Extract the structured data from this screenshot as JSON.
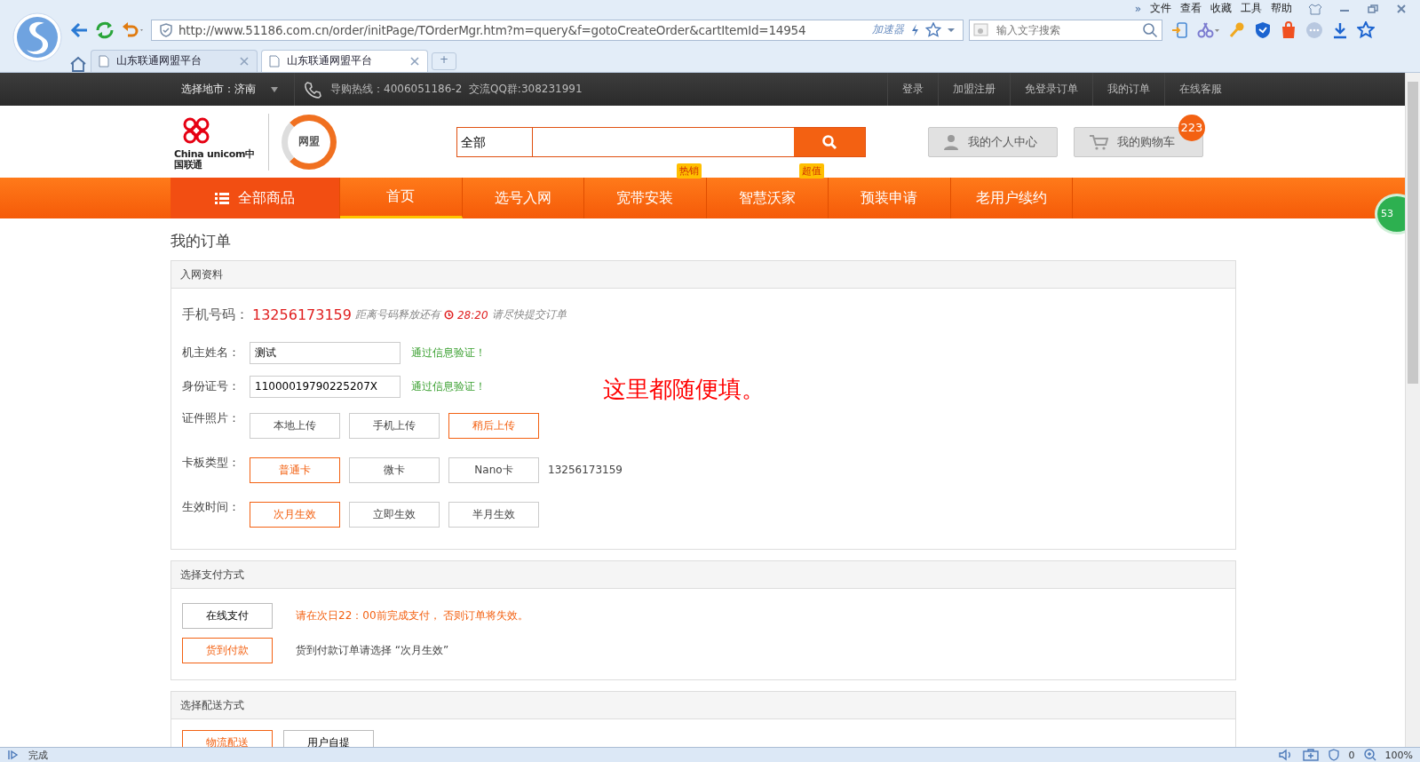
{
  "browser": {
    "more": "»",
    "menu": [
      "文件",
      "查看",
      "收藏",
      "工具",
      "帮助"
    ],
    "address": "http://www.51186.com.cn/order/initPage/TOrderMgr.htm?m=query&f=gotoCreateOrder&cartItemId=14954",
    "accelerator": "加速器",
    "search": {
      "placeholder": "输入文字搜索"
    },
    "tabs": [
      {
        "title": "山东联通网盟平台",
        "selected": false
      },
      {
        "title": "山东联通网盟平台",
        "selected": true
      }
    ],
    "new_tab": "+",
    "side_badge": "53"
  },
  "topbar": {
    "city": "选择地市：济南",
    "hotline": "导购热线：4006051186-2  交流QQ群:308231991",
    "links": [
      "登录",
      "加盟注册",
      "免登录订单",
      "我的订单",
      "在线客服"
    ]
  },
  "header": {
    "logo_text": "China unicom中国联通",
    "brand": "网盟",
    "search_category": "全部",
    "user_center": "我的个人中心",
    "cart": "我的购物车",
    "cart_count": "223"
  },
  "nav": [
    {
      "label": "全部商品",
      "kind": "menu",
      "selected": false
    },
    {
      "label": "首页",
      "kind": "link",
      "selected": true
    },
    {
      "label": "选号入网",
      "kind": "link",
      "selected": false
    },
    {
      "label": "宽带安装",
      "kind": "link",
      "selected": false,
      "badge": "热销"
    },
    {
      "label": "智慧沃家",
      "kind": "link",
      "selected": false,
      "badge": "超值"
    },
    {
      "label": "预装申请",
      "kind": "link",
      "selected": false
    },
    {
      "label": "老用户续约",
      "kind": "link",
      "selected": false
    }
  ],
  "page_title": "我的订单",
  "info": {
    "title": "入网资料",
    "phone_label": "手机号码：",
    "phone": "13256173159",
    "release_note": "距离号码释放还有",
    "countdown": "28:20",
    "submit_note": "请尽快提交订单",
    "name": {
      "label": "机主姓名：",
      "value": "测试",
      "status": "通过信息验证！"
    },
    "id": {
      "label": "身份证号：",
      "value": "11000019790225207X",
      "status": "通过信息验证！"
    },
    "annotation": "这里都随便填。",
    "choices": [
      {
        "label": "证件照片：",
        "options": [
          {
            "label": "本地上传",
            "selected": false
          },
          {
            "label": "手机上传",
            "selected": false
          },
          {
            "label": "稍后上传",
            "selected": true
          }
        ]
      },
      {
        "label": "卡板类型：",
        "options": [
          {
            "label": "普通卡",
            "selected": true
          },
          {
            "label": "微卡",
            "selected": false
          },
          {
            "label": "Nano卡",
            "selected": false
          }
        ],
        "note": "13256173159"
      },
      {
        "label": "生效时间：",
        "options": [
          {
            "label": "次月生效",
            "selected": true
          },
          {
            "label": "立即生效",
            "selected": false
          },
          {
            "label": "半月生效",
            "selected": false
          }
        ]
      }
    ]
  },
  "payment": {
    "title": "选择支付方式",
    "options": [
      {
        "label": "在线支付",
        "selected": false,
        "note": "请在次日22：00前完成支付， 否则订单将失效。",
        "warning": true
      },
      {
        "label": "货到付款",
        "selected": true,
        "note": "货到付款订单请选择 “次月生效”",
        "warning": false
      }
    ]
  },
  "delivery": {
    "title": "选择配送方式",
    "options": [
      {
        "label": "物流配送",
        "selected": true
      },
      {
        "label": "用户自提",
        "selected": false
      }
    ]
  },
  "status_bar": {
    "text": "完成",
    "ad_count": "0",
    "zoom": "100%"
  }
}
